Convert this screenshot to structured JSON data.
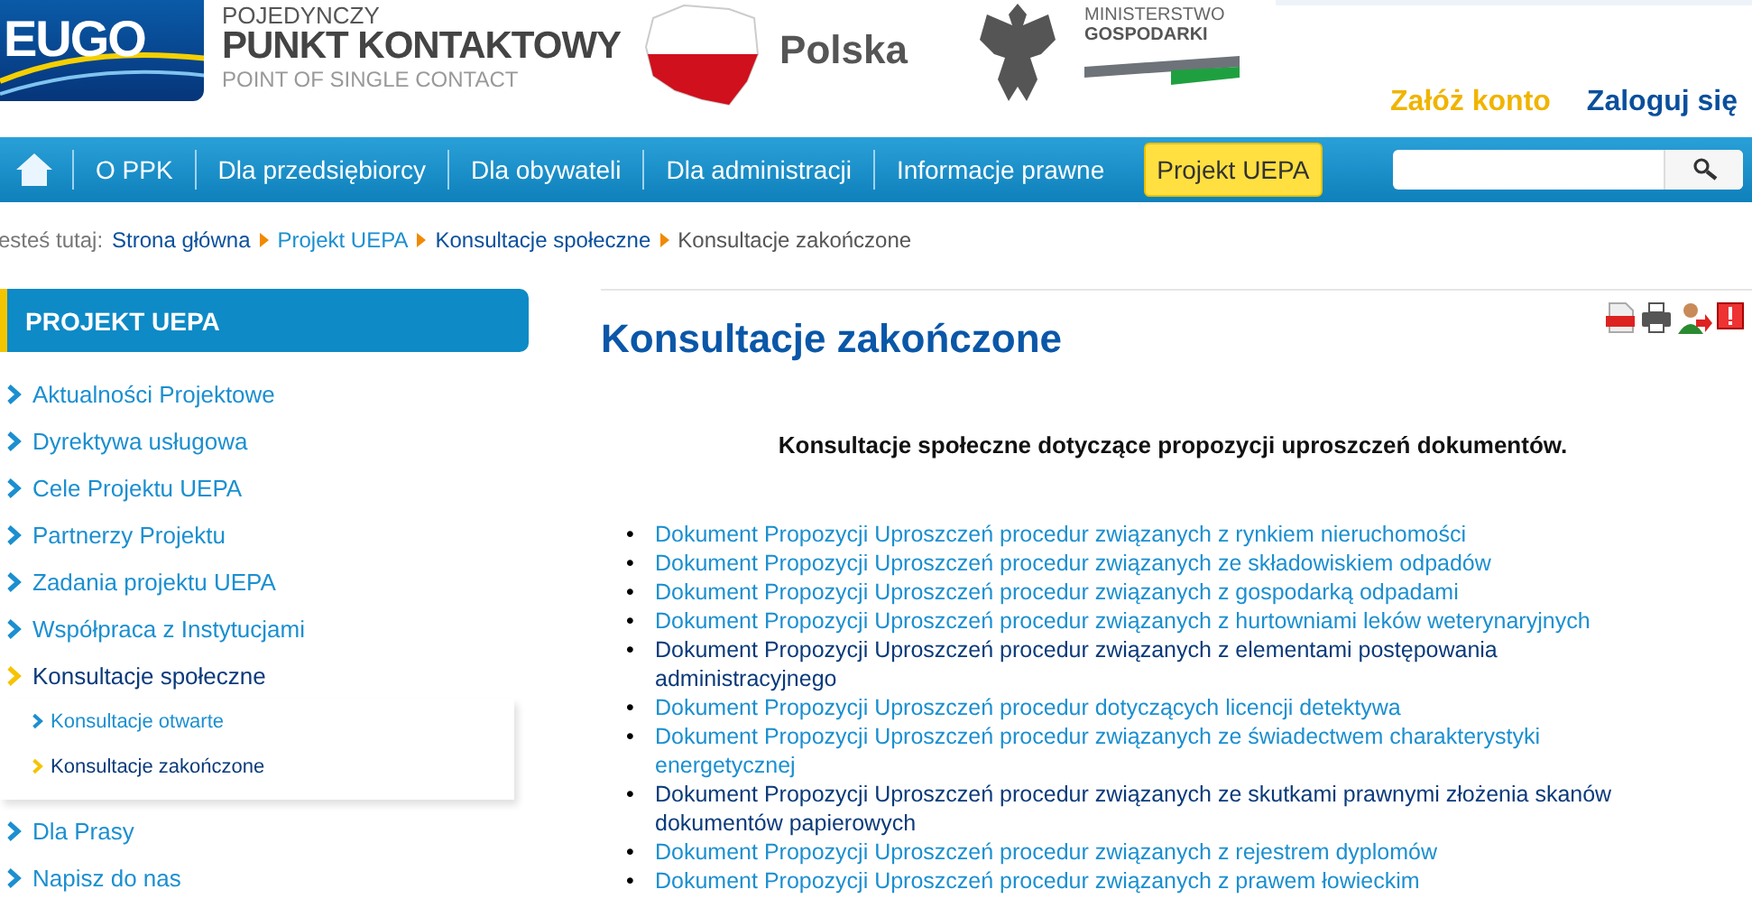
{
  "header": {
    "logo_text": "EUGO",
    "brand_line1": "POJEDYNCZY",
    "brand_line2": "PUNKT KONTAKTOWY",
    "brand_line3": "POINT OF SINGLE CONTACT",
    "country": "Polska",
    "ministry_line1": "MINISTERSTWO",
    "ministry_line2": "GOSPODARKI"
  },
  "account": [
    {
      "label": "Załóż konto",
      "kind": "register"
    },
    {
      "label": "Zaloguj się",
      "kind": "login"
    }
  ],
  "nav": [
    {
      "label": "O PPK",
      "selected": false
    },
    {
      "label": "Dla przedsiębiorcy",
      "selected": false
    },
    {
      "label": "Dla obywateli",
      "selected": false
    },
    {
      "label": "Dla administracji",
      "selected": false
    },
    {
      "label": "Informacje prawne",
      "selected": false
    },
    {
      "label": "Projekt UEPA",
      "selected": true
    }
  ],
  "breadcrumb": {
    "prefix": "esteś tutaj:",
    "items": [
      "Strona główna",
      "Projekt UEPA",
      "Konsultacje społeczne"
    ],
    "current": "Konsultacje zakończone"
  },
  "sidebar": {
    "title": "PROJEKT UEPA",
    "items": [
      {
        "label": "Aktualności Projektowe",
        "selected": false
      },
      {
        "label": "Dyrektywa usługowa",
        "selected": false
      },
      {
        "label": "Cele Projektu UEPA",
        "selected": false
      },
      {
        "label": "Partnerzy Projektu",
        "selected": false
      },
      {
        "label": "Zadania projektu UEPA",
        "selected": false
      },
      {
        "label": "Współpraca z Instytucjami",
        "selected": false
      },
      {
        "label": "Konsultacje społeczne",
        "selected": true,
        "children": [
          {
            "label": "Konsultacje otwarte",
            "selected": false
          },
          {
            "label": "Konsultacje zakończone",
            "selected": true
          }
        ]
      },
      {
        "label": "Dla Prasy",
        "selected": false
      },
      {
        "label": "Napisz do nas",
        "selected": false
      }
    ]
  },
  "content": {
    "title": "Konsultacje zakończone",
    "bullet": "•",
    "intro": "Konsultacje społeczne dotyczące propozycji uproszczeń dokumentów.",
    "documents": [
      {
        "label": "Dokument Propozycji Uproszczeń procedur związanych z rynkiem nieruchomości",
        "visited": false
      },
      {
        "label": "Dokument Propozycji Uproszczeń procedur związanych ze składowiskiem odpadów",
        "visited": false
      },
      {
        "label": "Dokument Propozycji Uproszczeń procedur związanych z gospodarką odpadami",
        "visited": false
      },
      {
        "label": "Dokument Propozycji Uproszczeń procedur związanych z hurtowniami leków weterynaryjnych",
        "visited": false
      },
      {
        "label": "Dokument Propozycji Uproszczeń procedur związanych z elementami postępowania administracyjnego",
        "visited": true
      },
      {
        "label": "Dokument Propozycji Uproszczeń procedur dotyczących licencji detektywa",
        "visited": false
      },
      {
        "label": "Dokument Propozycji Uproszczeń procedur związanych ze świadectwem charakterystyki energetycznej",
        "visited": false
      },
      {
        "label": "Dokument Propozycji Uproszczeń procedur związanych ze skutkami prawnymi złożenia skanów dokumentów papierowych",
        "visited": true
      },
      {
        "label": "Dokument Propozycji Uproszczeń procedur związanych z rejestrem dyplomów",
        "visited": false
      },
      {
        "label": "Dokument Propozycji Uproszczeń procedur związanych z prawem łowieckim",
        "visited": false
      }
    ]
  }
}
